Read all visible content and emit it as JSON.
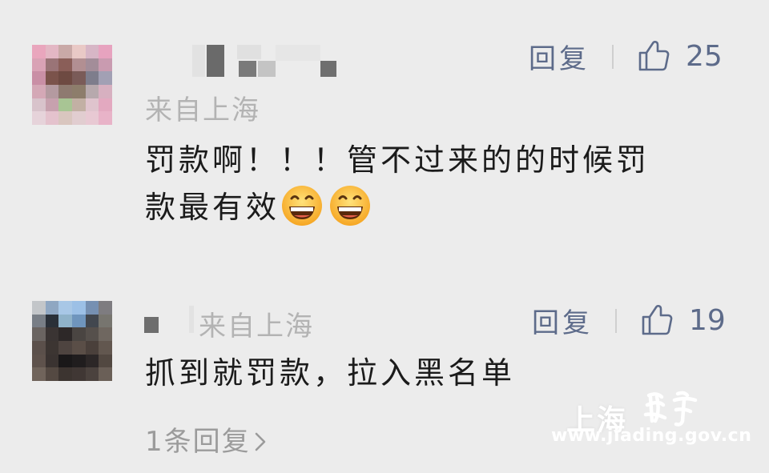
{
  "comments": [
    {
      "location": "来自上海",
      "reply_label": "回复",
      "like_count": "25",
      "text_line1": "罚款啊！！！管不过来的的时候罚",
      "text_line2": "款最有效",
      "emojis": [
        "grinning-face-emoji",
        "grinning-face-emoji"
      ]
    },
    {
      "location": "来自上海",
      "reply_label": "回复",
      "like_count": "19",
      "text_line1": "抓到就罚款，拉入黑名单",
      "more_replies": "1条回复"
    }
  ],
  "watermark": {
    "region": "上海",
    "brand": "嘉定",
    "url": "www.jiading.gov.cn"
  },
  "colors": {
    "background": "#ececec",
    "action": "#5d6b8a",
    "meta": "#b3b3b3"
  },
  "icons": [
    "thumbs-up-icon",
    "chevron-right-icon"
  ]
}
